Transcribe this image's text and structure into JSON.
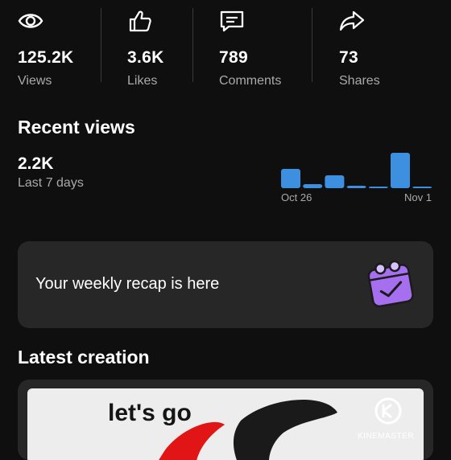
{
  "stats": [
    {
      "value": "125.2K",
      "label": "Views",
      "icon": "eye-icon"
    },
    {
      "value": "3.6K",
      "label": "Likes",
      "icon": "thumbs-up-icon"
    },
    {
      "value": "789",
      "label": "Comments",
      "icon": "comment-icon"
    },
    {
      "value": "73",
      "label": "Shares",
      "icon": "share-icon"
    }
  ],
  "recent_views": {
    "title": "Recent views",
    "value": "2.2K",
    "subtitle": "Last 7 days",
    "start_label": "Oct 26",
    "end_label": "Nov 1",
    "bar_color": "#3d8fe0"
  },
  "chart_data": {
    "type": "bar",
    "categories": [
      "Oct 26",
      "",
      "",
      "",
      "",
      "",
      "Nov 1"
    ],
    "values": [
      24,
      5,
      16,
      3,
      1,
      44,
      2
    ],
    "xlabel": "",
    "ylabel": ""
  },
  "recap": {
    "text": "Your weekly recap is here",
    "icon": "weekly-recap-calendar-icon",
    "icon_color": "#a56ff0"
  },
  "latest": {
    "title": "Latest creation",
    "thumbnail_text": "let's go",
    "watermark": "KINEMASTER"
  }
}
